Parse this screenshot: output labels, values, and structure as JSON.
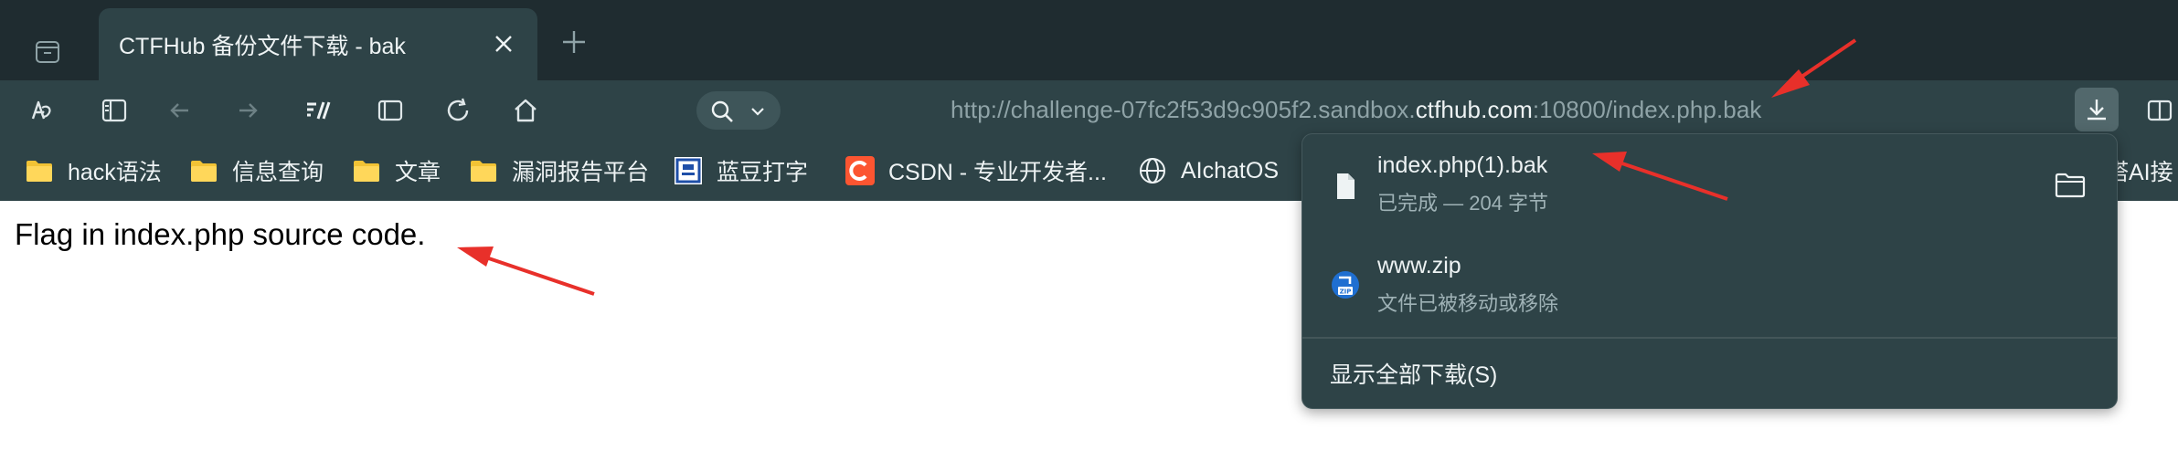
{
  "tab": {
    "title": "CTFHub 备份文件下载 - bak"
  },
  "toolbar": {
    "url_prefix": "http://challenge-07fc2f53d9c905f2.sandbox.",
    "url_host": "ctfhub.com",
    "url_suffix": ":10800/index.php.bak"
  },
  "bookmarks": [
    {
      "label": "hack语法",
      "icon": "folder-icon"
    },
    {
      "label": "信息查询",
      "icon": "folder-icon"
    },
    {
      "label": "文章",
      "icon": "folder-icon"
    },
    {
      "label": "漏洞报告平台",
      "icon": "folder-icon"
    },
    {
      "label": "蓝豆打字",
      "icon": "bluedou-icon"
    },
    {
      "label": "CSDN - 专业开发者...",
      "icon": "csdn-icon"
    },
    {
      "label": "AIchatOS",
      "icon": "globe-icon"
    },
    {
      "label": "塔AI接",
      "icon": "partial-bookmark"
    }
  ],
  "page": {
    "text": "Flag in index.php source code."
  },
  "downloads": {
    "items": [
      {
        "name": "index.php(1).bak",
        "status": "已完成 — 204 字节",
        "icon": "file-icon"
      },
      {
        "name": "www.zip",
        "status": "文件已被移动或移除",
        "icon": "zip-icon"
      }
    ],
    "show_all": "显示全部下载(S)"
  },
  "colors": {
    "tabstrip_bg": "#1f2c30",
    "toolbar_bg": "#2e4347",
    "annotation_arrow": "#e8302a"
  }
}
